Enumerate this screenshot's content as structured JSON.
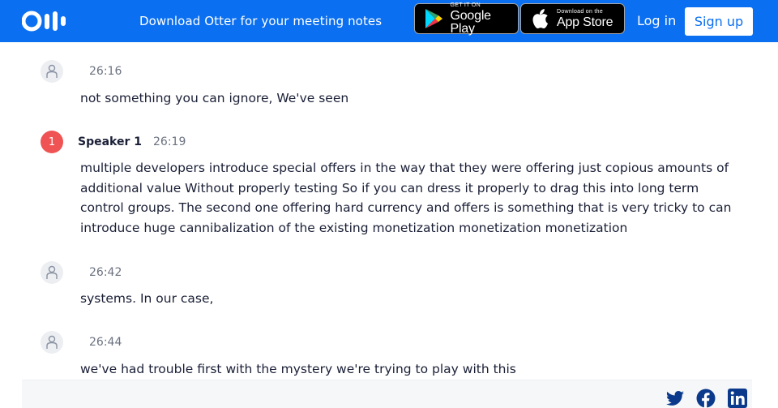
{
  "header": {
    "banner_text": "Download Otter for your meeting notes",
    "google_play": {
      "small": "GET IT ON",
      "big": "Google Play"
    },
    "app_store": {
      "small": "Download on the",
      "big": "App Store"
    },
    "login_label": "Log in",
    "signup_label": "Sign up",
    "brand_color": "#0a6ff0"
  },
  "transcript": {
    "segments": [
      {
        "speaker": "",
        "avatar": "user-icon",
        "time": "26:16",
        "text": "not something you can ignore, We've seen"
      },
      {
        "speaker": "Speaker 1",
        "avatar_number": "1",
        "time": "26:19",
        "text": "multiple developers introduce special offers in the way that they were offering just copious amounts of additional value Without properly testing So if you can dress it properly to drag this into long term control groups. The second one offering hard currency and offers is something that is very tricky to can introduce huge cannibalization of the existing monetization monetization monetization"
      },
      {
        "speaker": "",
        "avatar": "user-icon",
        "time": "26:42",
        "text": "systems. In our case,"
      },
      {
        "speaker": "",
        "avatar": "user-icon",
        "time": "26:44",
        "text": "we've had trouble first with the mystery we're trying to play with this"
      }
    ]
  },
  "share": {
    "icons": [
      "twitter-icon",
      "facebook-icon",
      "linkedin-icon"
    ],
    "icon_color": "#0b3a8c"
  }
}
